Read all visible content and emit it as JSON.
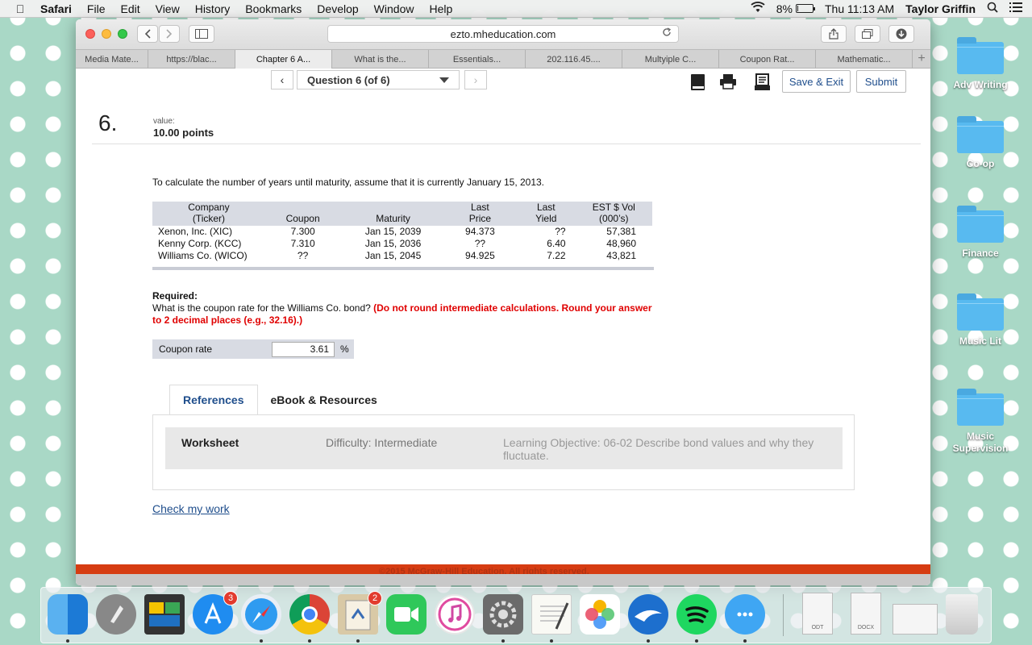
{
  "menubar": {
    "app": "Safari",
    "items": [
      "File",
      "Edit",
      "View",
      "History",
      "Bookmarks",
      "Develop",
      "Window",
      "Help"
    ],
    "battery": "8%",
    "battery_level": 0.08,
    "clock": "Thu 11:13 AM",
    "user": "Taylor Griffin"
  },
  "browser": {
    "url": "ezto.mheducation.com",
    "tabs": [
      {
        "label": "Media Mate..."
      },
      {
        "label": "https://blac..."
      },
      {
        "label": "Chapter 6 A..."
      },
      {
        "label": "What is the..."
      },
      {
        "label": "Essentials..."
      },
      {
        "label": "202.116.45...."
      },
      {
        "label": "Multyiple C..."
      },
      {
        "label": "Coupon Rat..."
      },
      {
        "label": "Mathematic..."
      }
    ],
    "active_tab": 2
  },
  "question_nav": {
    "prev": "‹",
    "next": "›",
    "selector": "Question 6 (of 6)",
    "save_exit": "Save & Exit",
    "submit": "Submit"
  },
  "question": {
    "number": "6.",
    "value_label": "value:",
    "points": "10.00 points",
    "intro": "To calculate the number of years until maturity, assume that it is currently January 15, 2013.",
    "table": {
      "headers": {
        "company_1": "Company",
        "company_2": "(Ticker)",
        "coupon": "Coupon",
        "maturity": "Maturity",
        "price_1": "Last",
        "price_2": "Price",
        "yield_1": "Last",
        "yield_2": "Yield",
        "vol_1": "EST $ Vol",
        "vol_2": "(000’s)"
      },
      "rows": [
        {
          "company": "Xenon, Inc. (XIC)",
          "coupon": "7.300",
          "maturity": "Jan 15, 2039",
          "price": "94.373",
          "yield": "??",
          "vol": "57,381"
        },
        {
          "company": "Kenny Corp. (KCC)",
          "coupon": "7.310",
          "maturity": "Jan 15, 2036",
          "price": "??",
          "yield": "6.40",
          "vol": "48,960"
        },
        {
          "company": "Williams Co. (WICO)",
          "coupon": "??",
          "maturity": "Jan 15, 2045",
          "price": "94.925",
          "yield": "7.22",
          "vol": "43,821"
        }
      ]
    },
    "required_title": "Required:",
    "required_text": "What is the coupon rate for the Williams Co. bond?",
    "required_note": "(Do not round intermediate calculations. Round your answer to 2 decimal places (e.g., 32.16).)",
    "answer_label": "Coupon rate",
    "answer_value": "3.61",
    "answer_unit": "%"
  },
  "references": {
    "tabs": [
      "References",
      "eBook & Resources"
    ],
    "worksheet": "Worksheet",
    "difficulty": "Difficulty: Intermediate",
    "objective": "Learning Objective: 06-02 Describe bond values and why they fluctuate.",
    "check_link": "Check my work"
  },
  "footer": {
    "copyright": "©2015 McGraw-Hill Education. All rights reserved."
  },
  "desktop": {
    "folders": [
      "Adv Writing",
      "Co-op",
      "Finance",
      "Music Lit",
      "Music Supervision"
    ]
  },
  "dock": {
    "app_store_badge": "3",
    "mail_badge": "2",
    "doc_labels": [
      "ODT",
      "DOCX"
    ]
  }
}
